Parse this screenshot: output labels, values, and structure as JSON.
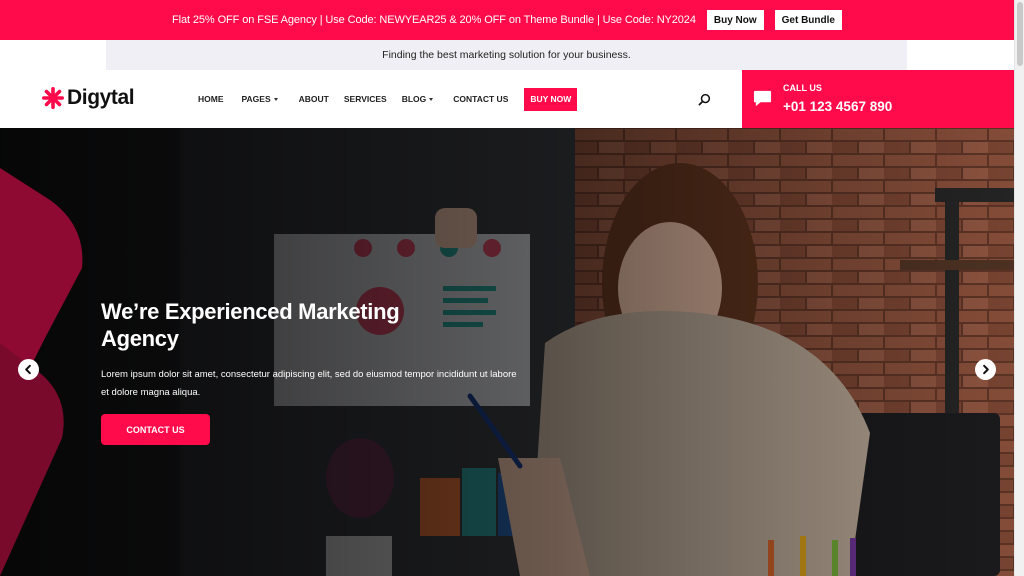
{
  "promo": {
    "text": "Flat 25% OFF on FSE Agency | Use Code: NEWYEAR25 & 20% OFF on Theme Bundle | Use Code: NY2024",
    "buy_label": "Buy Now",
    "bundle_label": "Get Bundle"
  },
  "tagline": "Finding the best marketing solution for your business.",
  "logo": {
    "text": "Digytal",
    "icon": "asterisk-logo-icon"
  },
  "nav": {
    "items": [
      {
        "label": "HOME",
        "dropdown": false
      },
      {
        "label": "PAGES",
        "dropdown": true
      },
      {
        "label": "ABOUT",
        "dropdown": false
      },
      {
        "label": "SERVICES",
        "dropdown": false
      },
      {
        "label": "BLOG",
        "dropdown": true
      },
      {
        "label": "CONTACT US",
        "dropdown": false
      }
    ],
    "buy_now": "BUY NOW",
    "search_icon": "search-icon"
  },
  "call": {
    "label": "CALL US",
    "number": "+01 123 4567 890",
    "icon": "chat-bubble-icon"
  },
  "hero": {
    "title": "We’re Experienced Marketing Agency",
    "description": "Lorem ipsum dolor sit amet, consectetur adipiscing elit, sed do eiusmod tempor incididunt ut labore et dolore magna aliqua.",
    "cta": "CONTACT US",
    "prev_icon": "chevron-left-icon",
    "next_icon": "chevron-right-icon"
  },
  "colors": {
    "accent": "#ff0a4a",
    "dark": "#1c1b1d",
    "tagline_bg": "#efeff5"
  }
}
